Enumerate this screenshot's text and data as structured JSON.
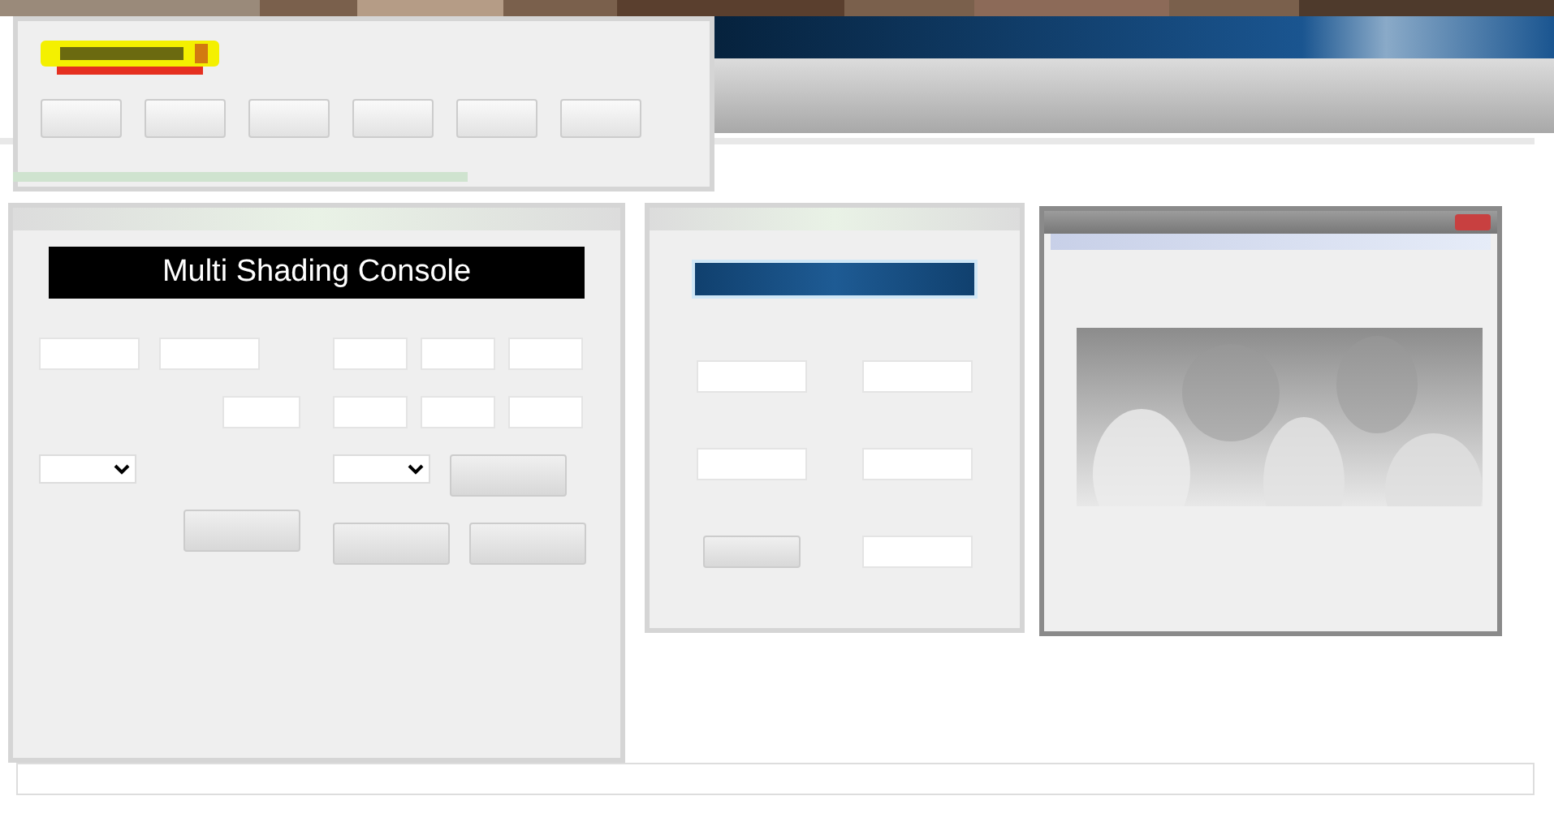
{
  "console_window": {
    "banner": "Multi Shading Console"
  }
}
